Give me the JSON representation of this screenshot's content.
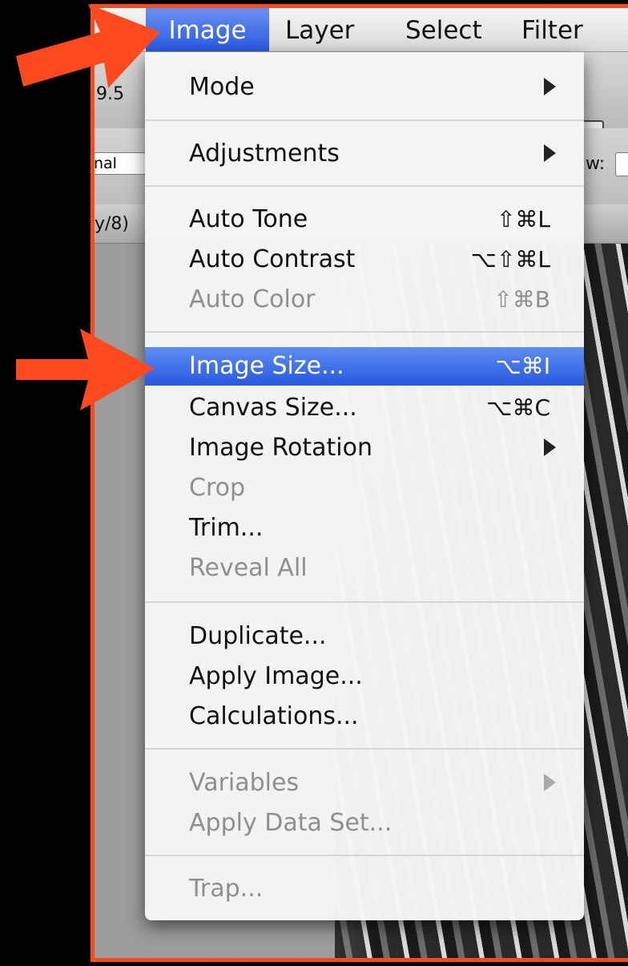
{
  "menubar": {
    "items": [
      {
        "label": "Image"
      },
      {
        "label": "Layer"
      },
      {
        "label": "Select"
      },
      {
        "label": "Filter"
      }
    ]
  },
  "background_fragments": {
    "zoom": "9.5",
    "blend": "nal",
    "w": "w:",
    "tab": "y/8)"
  },
  "image_menu": {
    "mode": {
      "label": "Mode"
    },
    "adjustments": {
      "label": "Adjustments"
    },
    "auto_tone": {
      "label": "Auto Tone",
      "shortcut": "⇧⌘L"
    },
    "auto_contrast": {
      "label": "Auto Contrast",
      "shortcut": "⌥⇧⌘L"
    },
    "auto_color": {
      "label": "Auto Color",
      "shortcut": "⇧⌘B"
    },
    "image_size": {
      "label": "Image Size...",
      "shortcut": "⌥⌘I"
    },
    "canvas_size": {
      "label": "Canvas Size...",
      "shortcut": "⌥⌘C"
    },
    "image_rotation": {
      "label": "Image Rotation"
    },
    "crop": {
      "label": "Crop"
    },
    "trim": {
      "label": "Trim..."
    },
    "reveal_all": {
      "label": "Reveal All"
    },
    "duplicate": {
      "label": "Duplicate..."
    },
    "apply_image": {
      "label": "Apply Image..."
    },
    "calculations": {
      "label": "Calculations..."
    },
    "variables": {
      "label": "Variables"
    },
    "apply_data_set": {
      "label": "Apply Data Set..."
    },
    "trap": {
      "label": "Trap..."
    }
  },
  "colors": {
    "annotation": "#ff4a1f",
    "highlight": "#2758de"
  }
}
